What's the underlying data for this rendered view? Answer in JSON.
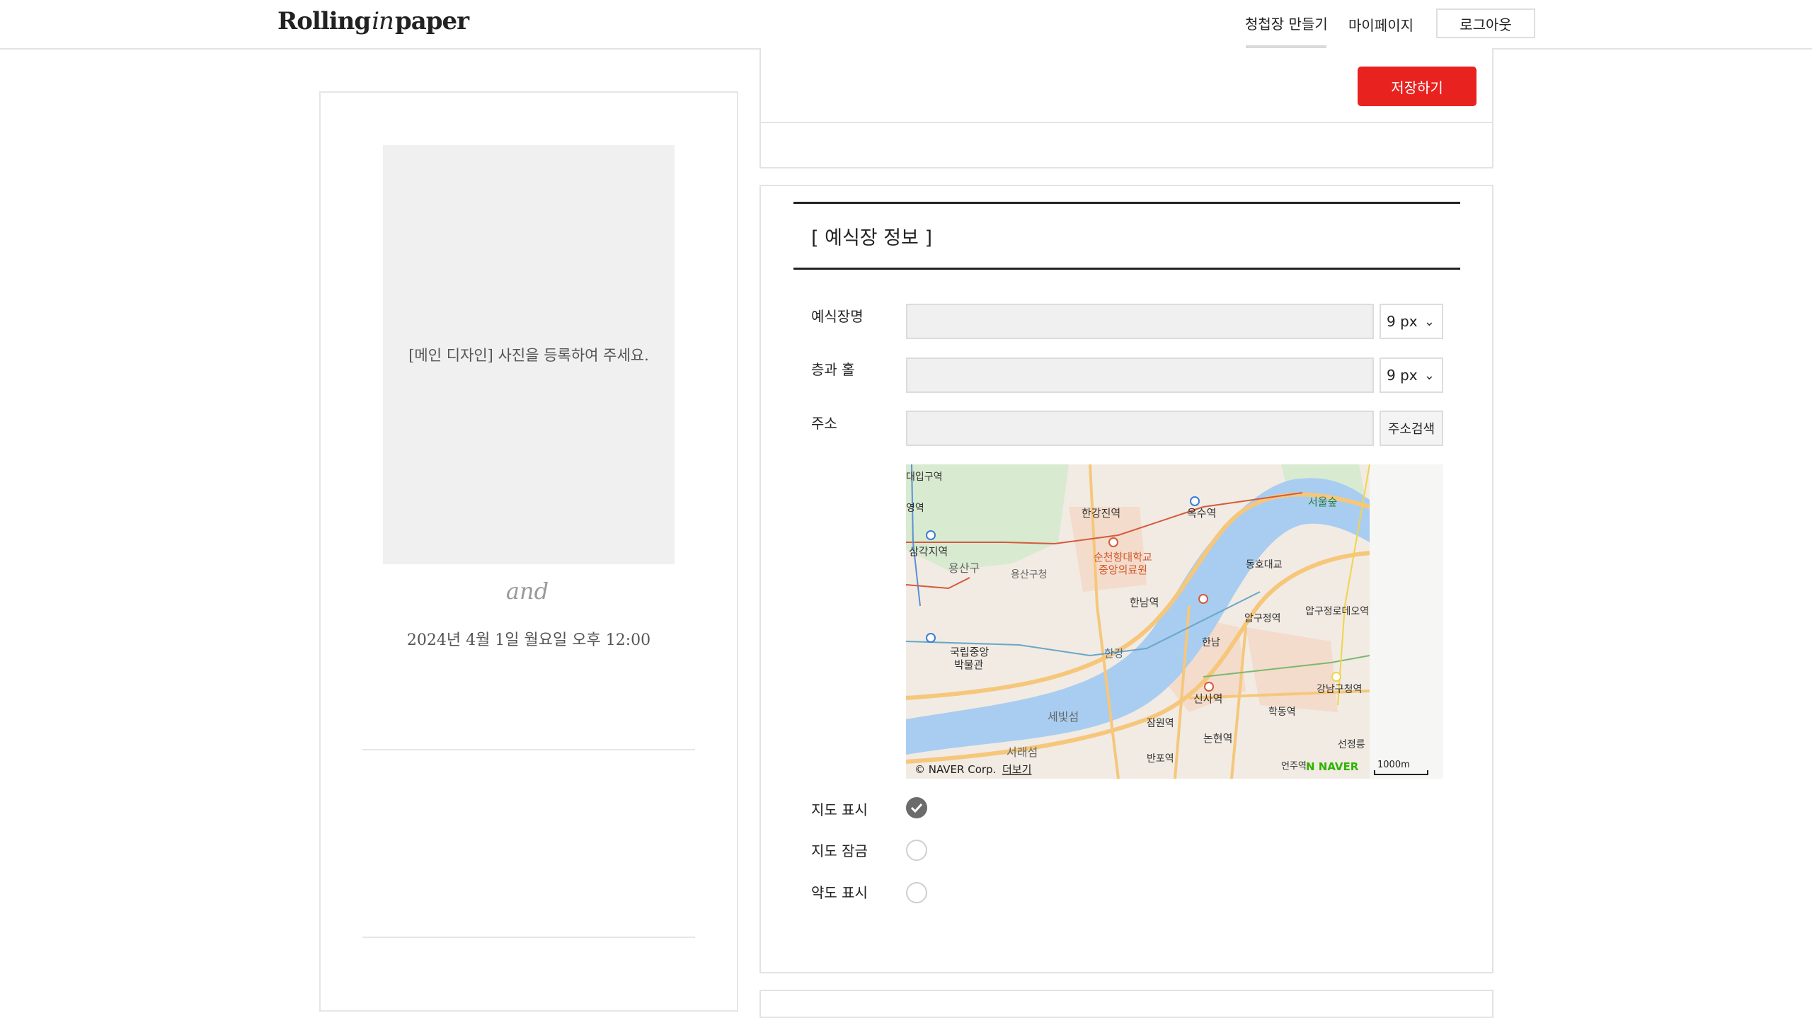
{
  "header": {
    "logo": {
      "part1": "Rolling",
      "part2": "in",
      "part3": "paper"
    },
    "nav_make": "청첩장 만들기",
    "nav_mypage": "마이페이지",
    "logout": "로그아웃"
  },
  "preview": {
    "photo_placeholder": "[메인 디자인] 사진을 등록하여 주세요.",
    "and": "and",
    "date": "2024년 4월 1일 월요일 오후 12:00"
  },
  "toolbar": {
    "save_label": "저장하기"
  },
  "venue": {
    "title": "[ 예식장 정보 ]",
    "name_label": "예식장명",
    "name_value": "",
    "name_size": "9 px",
    "hall_label": "층과 홀",
    "hall_value": "",
    "hall_size": "9 px",
    "address_label": "주소",
    "address_value": "",
    "address_search": "주소검색",
    "map_show_label": "지도 표시",
    "map_show_checked": true,
    "map_lock_label": "지도 잠금",
    "map_lock_checked": false,
    "sketch_label": "약도 표시",
    "sketch_checked": false
  },
  "map": {
    "labels": {
      "daeipgu": "대입구역",
      "yeongyeok": "영역",
      "samgakji": "삼각지역",
      "yongsangu": "용산구",
      "yongsanguhall": "용산구청",
      "hangangjin": "한강진역",
      "oksu": "옥수역",
      "seoulforest": "서울숲",
      "hospital1": "순천향대학교",
      "hospital2": "중앙의료원",
      "donghoBridge": "동호대교",
      "hannam_st": "한남역",
      "apgujeongrodeo": "압구정로데오역",
      "apgujeong": "압구정역",
      "hannam": "한남",
      "museum1": "국립중앙",
      "museum2": "박물관",
      "hangang": "한강",
      "sebitseom": "세빛섬",
      "seoraeseom": "서래섬",
      "jamwon": "잠원역",
      "sinsa": "신사역",
      "hakdong": "학동역",
      "gangnamgu": "강남구청역",
      "seonjeongneung": "선정릉",
      "nonhyeon": "논현역",
      "banpo": "반포역",
      "eonju": "언주역",
      "copyright": "© NAVER Corp.",
      "more": "더보기",
      "naver": "N NAVER",
      "scale": "1000m"
    },
    "colors": {
      "water": "#a8cdf1",
      "road": "#f6c77b",
      "green": "#d8ead0",
      "urban": "#f2e6dc",
      "line": "#d45a3c"
    }
  }
}
